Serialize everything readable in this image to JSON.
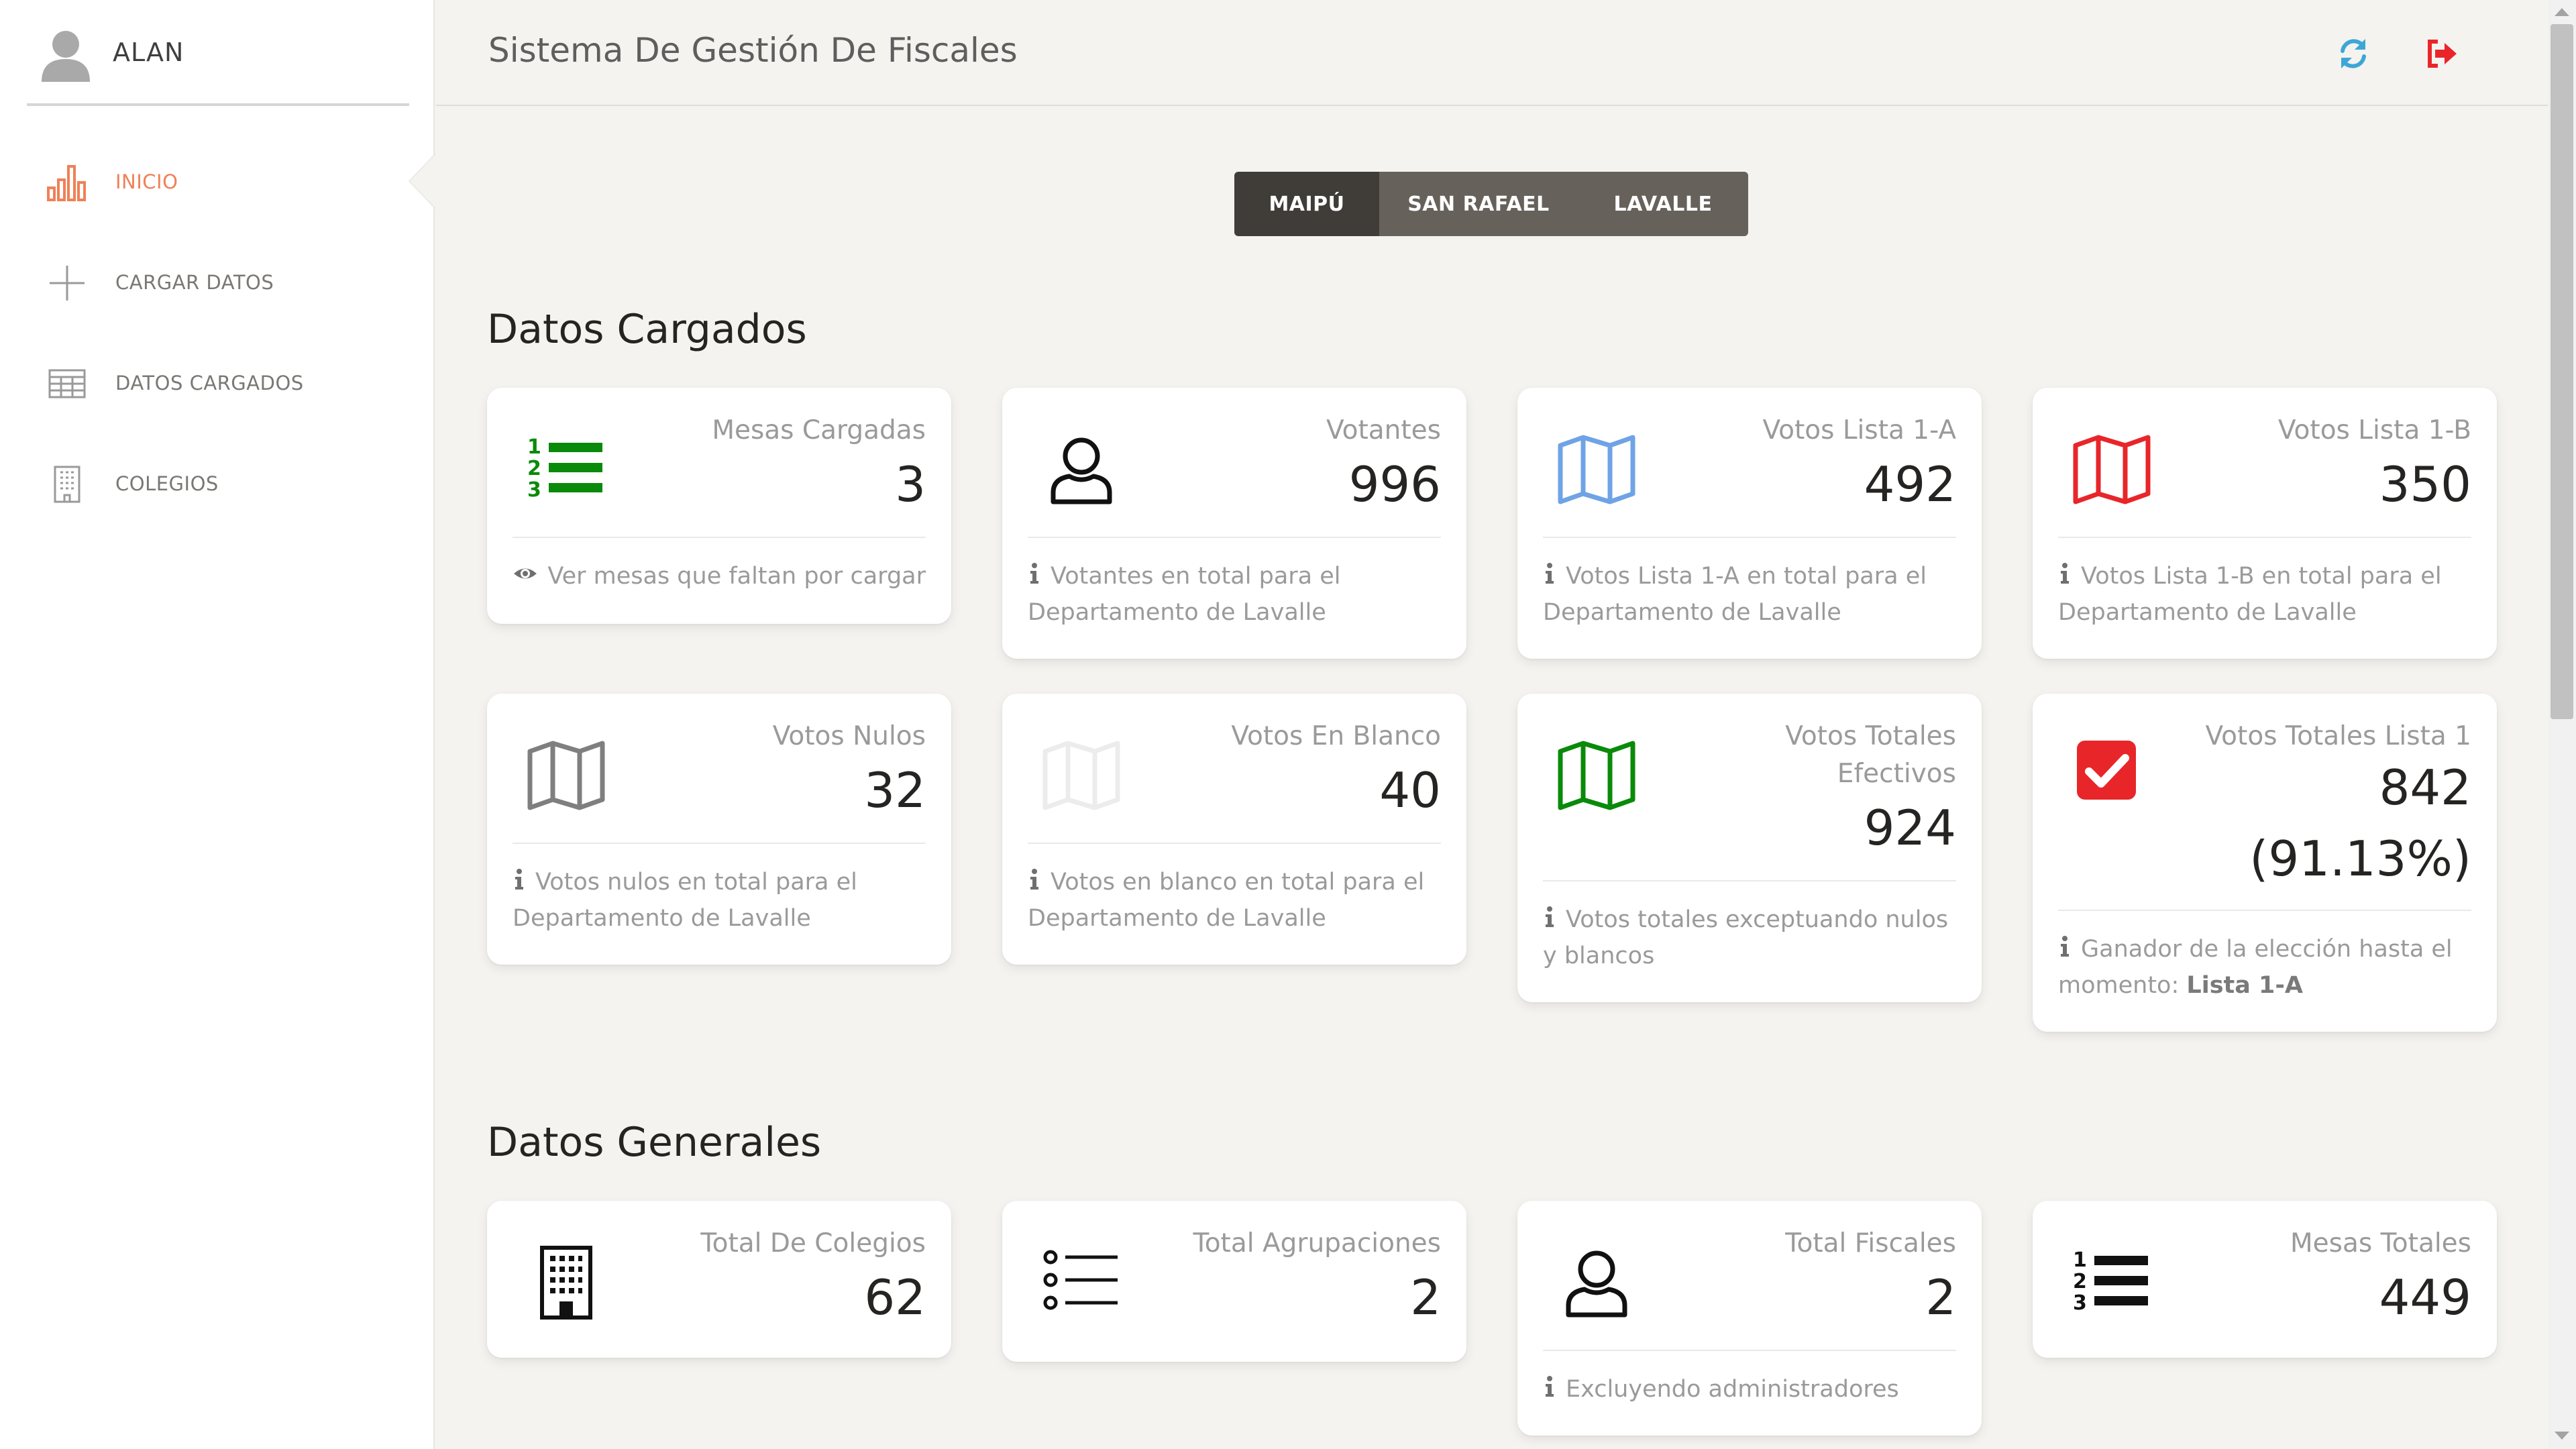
{
  "sidebar": {
    "user": {
      "name": "ALAN"
    },
    "items": [
      {
        "label": "INICIO",
        "icon": "bar-chart-icon",
        "active": true
      },
      {
        "label": "CARGAR DATOS",
        "icon": "plus-icon"
      },
      {
        "label": "DATOS CARGADOS",
        "icon": "table-icon"
      },
      {
        "label": "COLEGIOS",
        "icon": "building-icon"
      }
    ]
  },
  "header": {
    "title": "Sistema De Gestión De Fiscales",
    "refresh_icon": "refresh-icon",
    "logout_icon": "sign-out-icon"
  },
  "tabs": [
    {
      "label": "MAIPÚ",
      "active": true
    },
    {
      "label": "SAN RAFAEL"
    },
    {
      "label": "LAVALLE"
    }
  ],
  "sections": {
    "cargados": "Datos Cargados",
    "generales": "Datos Generales"
  },
  "cards_cargados": [
    {
      "label": "Mesas Cargadas",
      "value": "3",
      "icon": "ordered-list-icon",
      "footer": "Ver mesas que faltan por cargar",
      "footer_icon": "eye-icon"
    },
    {
      "label": "Votantes",
      "value": "996",
      "icon": "user-icon",
      "footer": "Votantes en total para el Departamento de Lavalle",
      "footer_icon": "info-icon"
    },
    {
      "label": "Votos Lista 1-A",
      "value": "492",
      "icon": "map-icon",
      "footer": "Votos Lista 1-A en total para el Departamento de Lavalle",
      "footer_icon": "info-icon"
    },
    {
      "label": "Votos Lista 1-B",
      "value": "350",
      "icon": "map-icon",
      "footer": "Votos Lista 1-B en total para el Departamento de Lavalle",
      "footer_icon": "info-icon"
    },
    {
      "label": "Votos Nulos",
      "value": "32",
      "icon": "map-icon",
      "footer": "Votos nulos en total para el Departamento de Lavalle",
      "footer_icon": "info-icon"
    },
    {
      "label": "Votos En Blanco",
      "value": "40",
      "icon": "map-icon",
      "footer": "Votos en blanco en total para el Departamento de Lavalle",
      "footer_icon": "info-icon"
    },
    {
      "label_line1": "Votos Totales",
      "label_line2": "Efectivos",
      "value": "924",
      "icon": "map-icon",
      "footer": "Votos totales exceptuando nulos y blancos",
      "footer_icon": "info-icon"
    },
    {
      "label": "Votos Totales Lista 1",
      "value": "842",
      "value2": "(91.13%)",
      "icon": "check-square-icon",
      "footer": "Ganador de la elección hasta el momento:",
      "footer_bold": "Lista 1-A",
      "footer_icon": "info-icon"
    }
  ],
  "cards_generales": [
    {
      "label": "Total De Colegios",
      "value": "62",
      "icon": "building-icon"
    },
    {
      "label": "Total Agrupaciones",
      "value": "2",
      "icon": "list-icon"
    },
    {
      "label": "Total Fiscales",
      "value": "2",
      "icon": "user-icon",
      "footer": "Excluyendo administradores",
      "footer_icon": "info-icon"
    },
    {
      "label": "Mesas Totales",
      "value": "449",
      "icon": "ordered-list-icon"
    }
  ],
  "colors": {
    "accent": "#ef8157",
    "green": "#0a8a0a",
    "blue": "#6fa3e6",
    "red": "#e8262a",
    "gray": "#7f7f7f",
    "light": "#e7e7e7",
    "dark_btn": "#403d39",
    "btn": "#66615b"
  }
}
